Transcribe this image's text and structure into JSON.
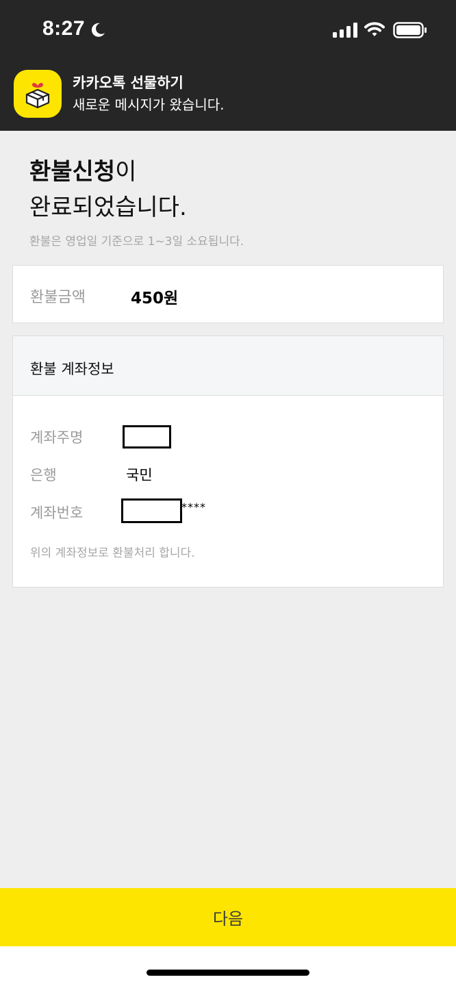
{
  "status_bar": {
    "time": "8:27"
  },
  "notification": {
    "app_name": "카카오톡 선물하기",
    "message": "새로운 메시지가 왔습니다."
  },
  "headline": {
    "bold_part": "환불신청",
    "normal_part": "이",
    "line2": "완료되었습니다."
  },
  "subnote": "환불은 영업일 기준으로 1~3일 소요됩니다.",
  "amount": {
    "label": "환불금액",
    "value": "450원"
  },
  "account": {
    "title": "환불 계좌정보",
    "holder_label": "계좌주명",
    "bank_label": "은행",
    "bank_value": "국민",
    "number_label": "계좌번호",
    "number_mask": "****",
    "footnote": "위의 계좌정보로 환불처리 합니다."
  },
  "next_button": "다음",
  "colors": {
    "brand_yellow": "#fee500",
    "dark_header": "#262626",
    "background": "#eeeeee"
  }
}
